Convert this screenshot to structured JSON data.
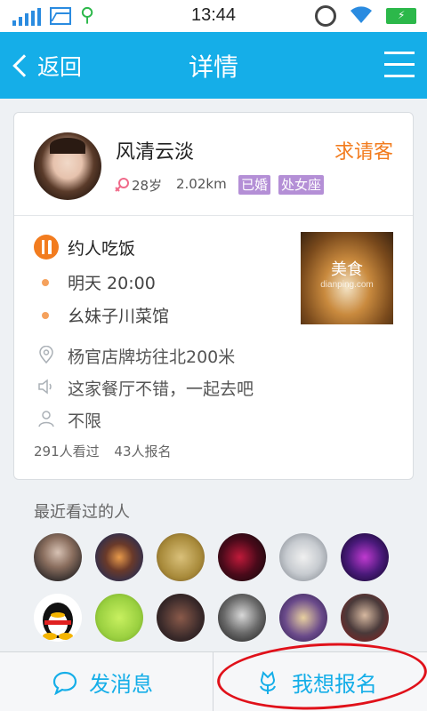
{
  "status_bar": {
    "time": "13:44"
  },
  "nav": {
    "back_label": "返回",
    "title": "详情"
  },
  "profile": {
    "name": "风清云淡",
    "treat_label": "求请客",
    "age": "28岁",
    "distance": "2.02km",
    "tags": [
      "已婚",
      "处女座"
    ]
  },
  "event": {
    "title": "约人吃饭",
    "time": "明天 20:00",
    "venue": "幺妹子川菜馆",
    "photo_label": "美食",
    "photo_watermark": "dianping.com",
    "address": "杨官店牌坊往北200米",
    "message": "这家餐厅不错，一起去吧",
    "requirement": "不限",
    "views": "291人看过",
    "signups": "43人报名"
  },
  "recent": {
    "title": "最近看过的人"
  },
  "bottom": {
    "message_label": "发消息",
    "join_label": "我想报名"
  },
  "colors": {
    "accent": "#15aee8",
    "orange": "#f27c1f",
    "tag": "#b48fd6",
    "annotation": "#e0111a"
  }
}
